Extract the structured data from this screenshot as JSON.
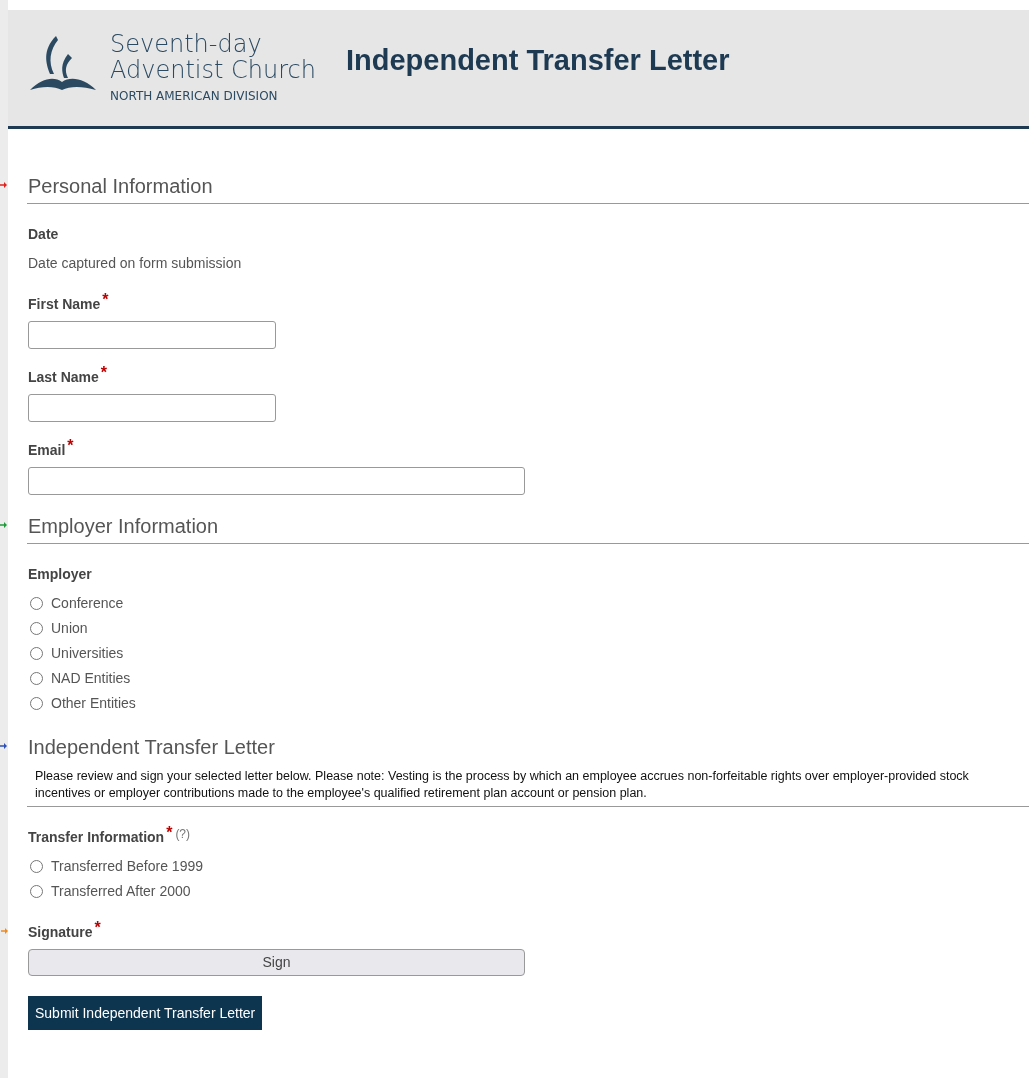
{
  "header": {
    "logo_line1": "Seventh-day",
    "logo_line2": "Adventist",
    "logo_line2b": "Church",
    "logo_line3": "NORTH AMERICAN DIVISION",
    "title": "Independent Transfer Letter"
  },
  "sections": [
    {
      "title": "Personal Information",
      "color": "#e0201c",
      "fields": [
        {
          "kind": "static",
          "label": "Date",
          "text": "Date captured on form submission"
        },
        {
          "kind": "text",
          "label": "First Name",
          "required": "*",
          "wide": false
        },
        {
          "kind": "text",
          "label": "Last Name",
          "required": "*",
          "wide": false
        },
        {
          "kind": "text",
          "label": "Email",
          "required": "*",
          "wide": true
        }
      ]
    },
    {
      "title": "Employer Information",
      "color": "#1e9a3c",
      "fields": [
        {
          "kind": "radio",
          "label": "Employer",
          "options": [
            {
              "label": "Conference",
              "selected": false
            },
            {
              "label": "Union",
              "selected": false
            },
            {
              "label": "Universities",
              "selected": false
            },
            {
              "label": "NAD Entities",
              "selected": false
            },
            {
              "label": "Other Entities",
              "selected": false
            }
          ]
        }
      ]
    },
    {
      "title": "Independent Transfer Letter",
      "color": "#2d4fb8",
      "note": "Please review and sign your selected letter below. Please note: Vesting is the process by which an employee accrues non-forfeitable rights over employer-provided stock incentives or employer contributions made to the employee's qualified retirement plan account or pension plan.",
      "fields": [
        {
          "kind": "radio",
          "label": "Transfer Information",
          "required": "*",
          "help": "(?)",
          "options": [
            {
              "label": "Transferred Before 1999",
              "selected": false
            },
            {
              "label": "Transferred After 2000",
              "selected": false
            }
          ]
        },
        {
          "kind": "signature",
          "label": "Signature",
          "required": "*",
          "color": "#f08a1c",
          "button": "Sign"
        }
      ]
    }
  ],
  "submit": "Submit Independent Transfer Letter"
}
